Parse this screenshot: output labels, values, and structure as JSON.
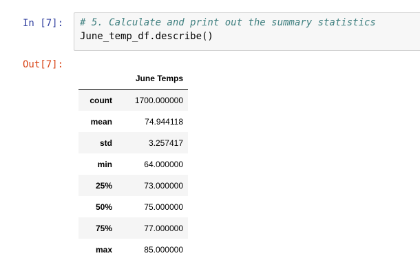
{
  "input_cell": {
    "prompt": "In [7]:",
    "code_comment": "# 5. Calculate and print out the summary statistics",
    "code_line2": "June_temp_df.describe()"
  },
  "output_cell": {
    "prompt": "Out[7]:",
    "table": {
      "column_header": "June Temps",
      "rows": [
        {
          "label": "count",
          "value": "1700.000000"
        },
        {
          "label": "mean",
          "value": "74.944118"
        },
        {
          "label": "std",
          "value": "3.257417"
        },
        {
          "label": "min",
          "value": "64.000000"
        },
        {
          "label": "25%",
          "value": "73.000000"
        },
        {
          "label": "50%",
          "value": "75.000000"
        },
        {
          "label": "75%",
          "value": "77.000000"
        },
        {
          "label": "max",
          "value": "85.000000"
        }
      ]
    }
  },
  "colors": {
    "in_prompt": "#303f9f",
    "out_prompt": "#d84315",
    "comment": "#408080",
    "code_bg": "#f7f7f7",
    "striped_row_bg": "#f5f5f5"
  }
}
